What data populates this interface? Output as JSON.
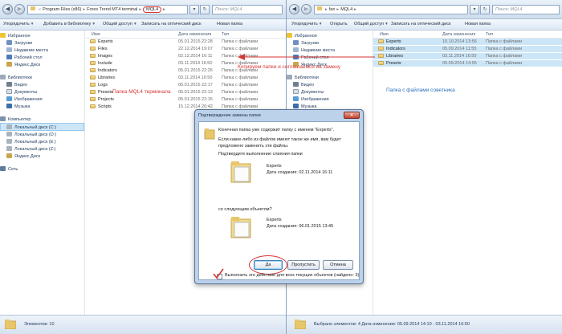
{
  "left": {
    "breadcrumb": [
      "Program Files (x86)",
      "Forex Trend MT4 terminal",
      "MQL4"
    ],
    "search_placeholder": "Поиск: MQL4",
    "toolbar": {
      "organize": "Упорядочить",
      "library": "Добавить в библиотеку",
      "share": "Общий доступ",
      "burn": "Записать на оптический диск",
      "new_folder": "Новая папка"
    },
    "nav": {
      "favorites": "Избранное",
      "downloads": "Загрузки",
      "recent": "Недавние места",
      "desktop": "Рабочий стол",
      "yadisk": "Яндекс.Диск",
      "libraries": "Библиотеки",
      "video": "Видео",
      "documents": "Документы",
      "images": "Изображения",
      "music": "Музыка",
      "computer": "Компьютер",
      "drive_c": "Локальный диск (C:)",
      "drive_d": "Локальный диск (D:)",
      "drive_e": "Локальный диск (E:)",
      "drive_z": "Локальный диск (Z:)",
      "yadisk2": "Яндекс.Диск",
      "network": "Сеть"
    },
    "columns": {
      "name": "Имя",
      "date": "Дата изменения",
      "type": "Тип"
    },
    "files": [
      {
        "name": "Experts",
        "date": "05.01.2015 22:28",
        "type": "Папка с файлами"
      },
      {
        "name": "Files",
        "date": "22.12.2014 19:07",
        "type": "Папка с файлами"
      },
      {
        "name": "Images",
        "date": "02.12.2014 16:11",
        "type": "Папка с файлами"
      },
      {
        "name": "Include",
        "date": "03.11.2014 16:50",
        "type": "Папка с файлами"
      },
      {
        "name": "Indicators",
        "date": "05.01.2015 22:26",
        "type": "Папка с файлами"
      },
      {
        "name": "Libraries",
        "date": "03.11.2014 16:50",
        "type": "Папка с файлами"
      },
      {
        "name": "Logs",
        "date": "05.01.2015 22:17",
        "type": "Папка с файлами"
      },
      {
        "name": "Presets",
        "date": "05.01.2015 22:13",
        "type": "Папка с файлами"
      },
      {
        "name": "Projects",
        "date": "05.01.2015 22:15",
        "type": "Папка с файлами"
      },
      {
        "name": "Scripts",
        "date": "15.12.2014 20:42",
        "type": "Папка с файлами"
      }
    ],
    "annotation": "Папка MQL4 терминала",
    "status": "Элементов: 10"
  },
  "right": {
    "breadcrumb": [
      "fan",
      "MQL4"
    ],
    "search_placeholder": "Поиск: MQL4",
    "toolbar": {
      "organize": "Упорядочить",
      "open": "Открыть",
      "share": "Общий доступ",
      "burn": "Записать на оптический диск",
      "new_folder": "Новая папка"
    },
    "nav": {
      "favorites": "Избранное",
      "downloads": "Загрузки",
      "recent": "Недавние места",
      "desktop": "Рабочий стол",
      "yadisk": "Яндекс.Диск",
      "libraries": "Библиотеки",
      "video": "Видео",
      "documents": "Документы",
      "images": "Изображения",
      "music": "Музыка"
    },
    "columns": {
      "name": "Имя",
      "date": "Дата изменения",
      "type": "Тип"
    },
    "files": [
      {
        "name": "Experts",
        "date": "10.10.2014 13:56",
        "type": "Папка с файлами"
      },
      {
        "name": "Indicators",
        "date": "05.09.2014 11:55",
        "type": "Папка с файлами"
      },
      {
        "name": "Libraries",
        "date": "03.11.2014 16:50",
        "type": "Папка с файлами"
      },
      {
        "name": "Presets",
        "date": "05.09.2014 14:55",
        "type": "Папка с файлами"
      }
    ],
    "annotation": "Папка с файлами советника",
    "status": "Выбрано элементов: 4  Дата изменения: 05.09.2014 14:10 - 03.11.2014 16:50"
  },
  "copy_annotation": "Копируем папки и соглашаемся на замену",
  "dialog": {
    "title": "Подтверждение замены папки",
    "line1": "Конечная папка уже содержит папку с именем \"Experts\".",
    "line2": "Если какие-либо из файлов имеют такое же имя, вам будет предложено заменить эти файлы.",
    "line3": "Подтвердите выполнение слияния папки",
    "existing_name": "Experts",
    "existing_date": "Дата создания: 02.11.2014 16:11",
    "with_label": "со следующим объектом?",
    "new_name": "Experts",
    "new_date": "Дата создания: 06.01.2015 13:45",
    "yes": "Да",
    "skip": "Пропустить",
    "cancel": "Отмена",
    "apply_all": "Выполнить это действие для всех текущих объектов (найдено: 3)"
  },
  "colors": {
    "annotation_red": "#d93636",
    "annotation_blue": "#2b6fbf",
    "folder": "#e8c66a"
  }
}
